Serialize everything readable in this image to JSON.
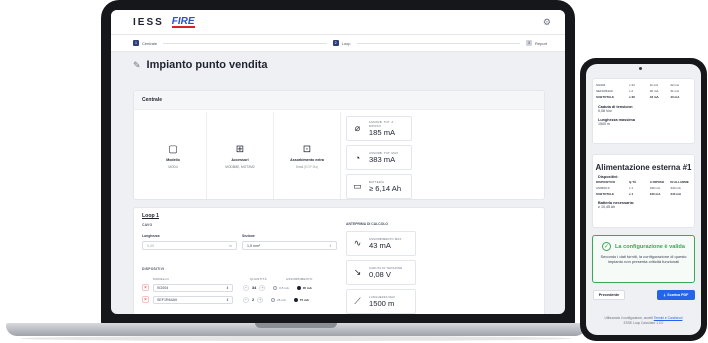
{
  "desktop": {
    "brand": {
      "iess": "IESS",
      "fire": "FIRE"
    },
    "stepper": [
      {
        "num": "1",
        "label": "Centrale"
      },
      {
        "num": "2",
        "label": "Loop"
      },
      {
        "num": "3",
        "label": "Report"
      }
    ],
    "page_title": "Impianto punto vendita",
    "centrale": {
      "title": "Centrale",
      "tiles": [
        {
          "icon": "panel-icon",
          "title": "Modello",
          "sub": "MOD4"
        },
        {
          "icon": "grid-plus-icon",
          "title": "Accessori",
          "sub": "MOD8ME, MOTXM2"
        },
        {
          "icon": "power-plus-icon",
          "title": "Assorbimento extra",
          "sub": "0 mA",
          "sub_muted": "(EOP Ma)"
        }
      ],
      "metrics": [
        {
          "icon": "bell-off-icon",
          "label": "ASSORB. TOT. A RIPOSO",
          "value": "185 mA"
        },
        {
          "icon": "alarm-icon",
          "label": "ASSORB. TOT. MAX",
          "value": "383 mA"
        },
        {
          "icon": "battery-icon",
          "label": "BATTERIA",
          "value": "≥ 6,14 Ah"
        }
      ]
    },
    "loop": {
      "title": "Loop 1",
      "cavo_label": "CAVO",
      "lunghezza_label": "Lunghezza",
      "lunghezza_value": "0,00",
      "lunghezza_unit": "m",
      "sezione_label": "Sezione",
      "sezione_value": "1,5 mm²",
      "dispositivi_label": "DISPOSITIVI",
      "col_modello": "MODELLO",
      "col_quantita": "QUANTITÀ",
      "col_assorbimento": "ASSORBIMENTO",
      "devices": [
        {
          "model": "SG004",
          "qty": "34",
          "opt_a": "0,5 mA",
          "opt_b": "35 mA"
        },
        {
          "model": "SEF1R64A9",
          "qty": "2",
          "opt_a": "25 mA",
          "opt_b": "75 mA"
        }
      ],
      "preview_title": "ANTEPRIMA DI CALCOLO",
      "preview": [
        {
          "icon": "wave-icon",
          "label": "ASSORBIMENTO MAX",
          "value": "43 mA"
        },
        {
          "icon": "trend-down-icon",
          "label": "CADUTA DI TENSIONE",
          "value": "0,08 V"
        },
        {
          "icon": "ruler-icon",
          "label": "LUNGHEZZA MAX",
          "value": "1500 m"
        }
      ]
    }
  },
  "mobile": {
    "table_rows": [
      [
        "SG004",
        "x 34",
        "11 mA",
        "22 mA"
      ],
      [
        "SEF1R64A9",
        "x 2",
        "30 mA",
        "31 mA"
      ],
      [
        "SUBTOTALE",
        "x 36",
        "43 mA",
        "43 mA"
      ]
    ],
    "caduta_label": "Caduta di tensione:",
    "caduta_value": "0,08 Vcc",
    "lunghezza_label": "Lunghezza massima",
    "lunghezza_value": "1500 m",
    "alim_title": "Alimentazione esterna #1",
    "dispositivi_label": "Dispositivi:",
    "alim_head": [
      "DISPOSITIVO",
      "Q.TÀ",
      "A RIPOSO",
      "IN ALLARME"
    ],
    "alim_rows": [
      [
        "AS0500-S",
        "x 1",
        "340 mA",
        "340 mA"
      ],
      [
        "SUBTOTALE",
        "x 1",
        "340 mA",
        "340 mA"
      ]
    ],
    "batteria_label": "Batteria necessaria:",
    "batteria_value": "≥ 10,45 Ah",
    "valid_title": "La configurazione è valida",
    "valid_msg": "Secondo i dati forniti, la configurazione di questo impianto non presenta criticità funzionali",
    "btn_prev": "Precedente",
    "btn_pdf": "Scarica PDF",
    "footer_text": "Utilizzando il configuratore, accetti",
    "footer_link": "Termini e Condizioni",
    "footer_version": "ESSE Loop Calculator 1.0.0"
  }
}
